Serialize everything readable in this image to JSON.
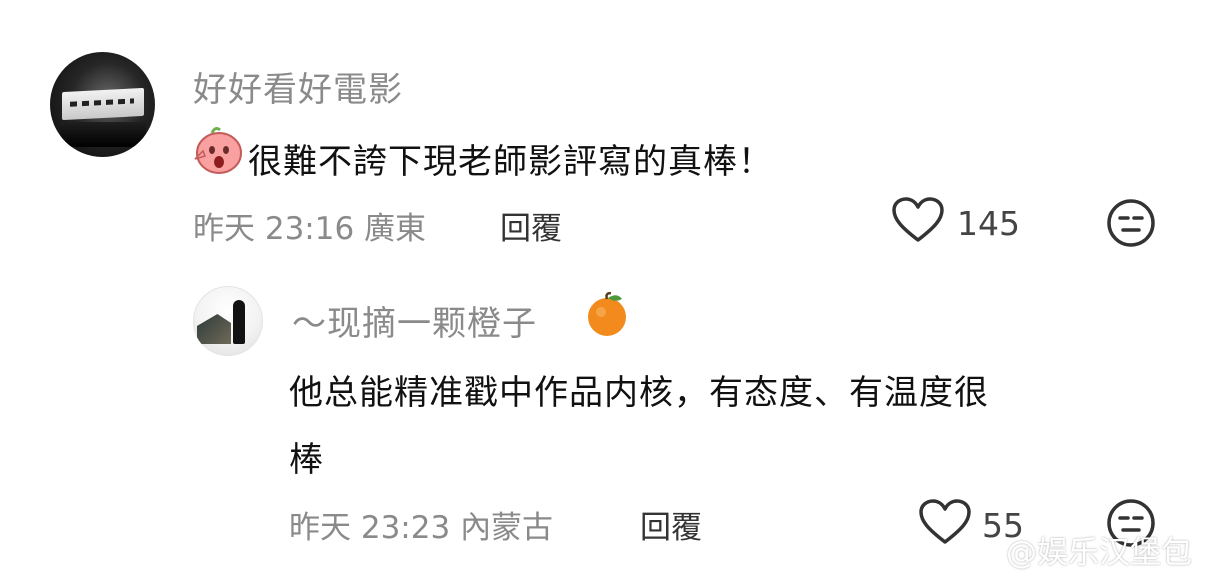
{
  "comment1": {
    "username": "好好看好電影",
    "text": "很難不誇下現老師影評寫的真棒！",
    "time": "昨天",
    "clock": "23:16",
    "location": "廣東",
    "reply_label": "回覆",
    "like_count": "145"
  },
  "comment2": {
    "username": "～现摘一颗橙子",
    "text_line1": "他总能精准戳中作品内核，有态度、有温度很",
    "text_line2": "棒",
    "time": "昨天",
    "clock": "23:23",
    "location": "內蒙古",
    "reply_label": "回覆",
    "like_count": "55"
  },
  "watermark": {
    "text": "@娱乐汉堡包"
  },
  "icons": {
    "heart": "heart-outline-icon",
    "dislike": "meh-face-icon",
    "emoji": "shocked-face-sticker",
    "orange": "orange-emoji"
  },
  "colors": {
    "text": "#111111",
    "meta": "#8a8a8a",
    "icon": "#333333",
    "orange": "#f28a1e"
  }
}
